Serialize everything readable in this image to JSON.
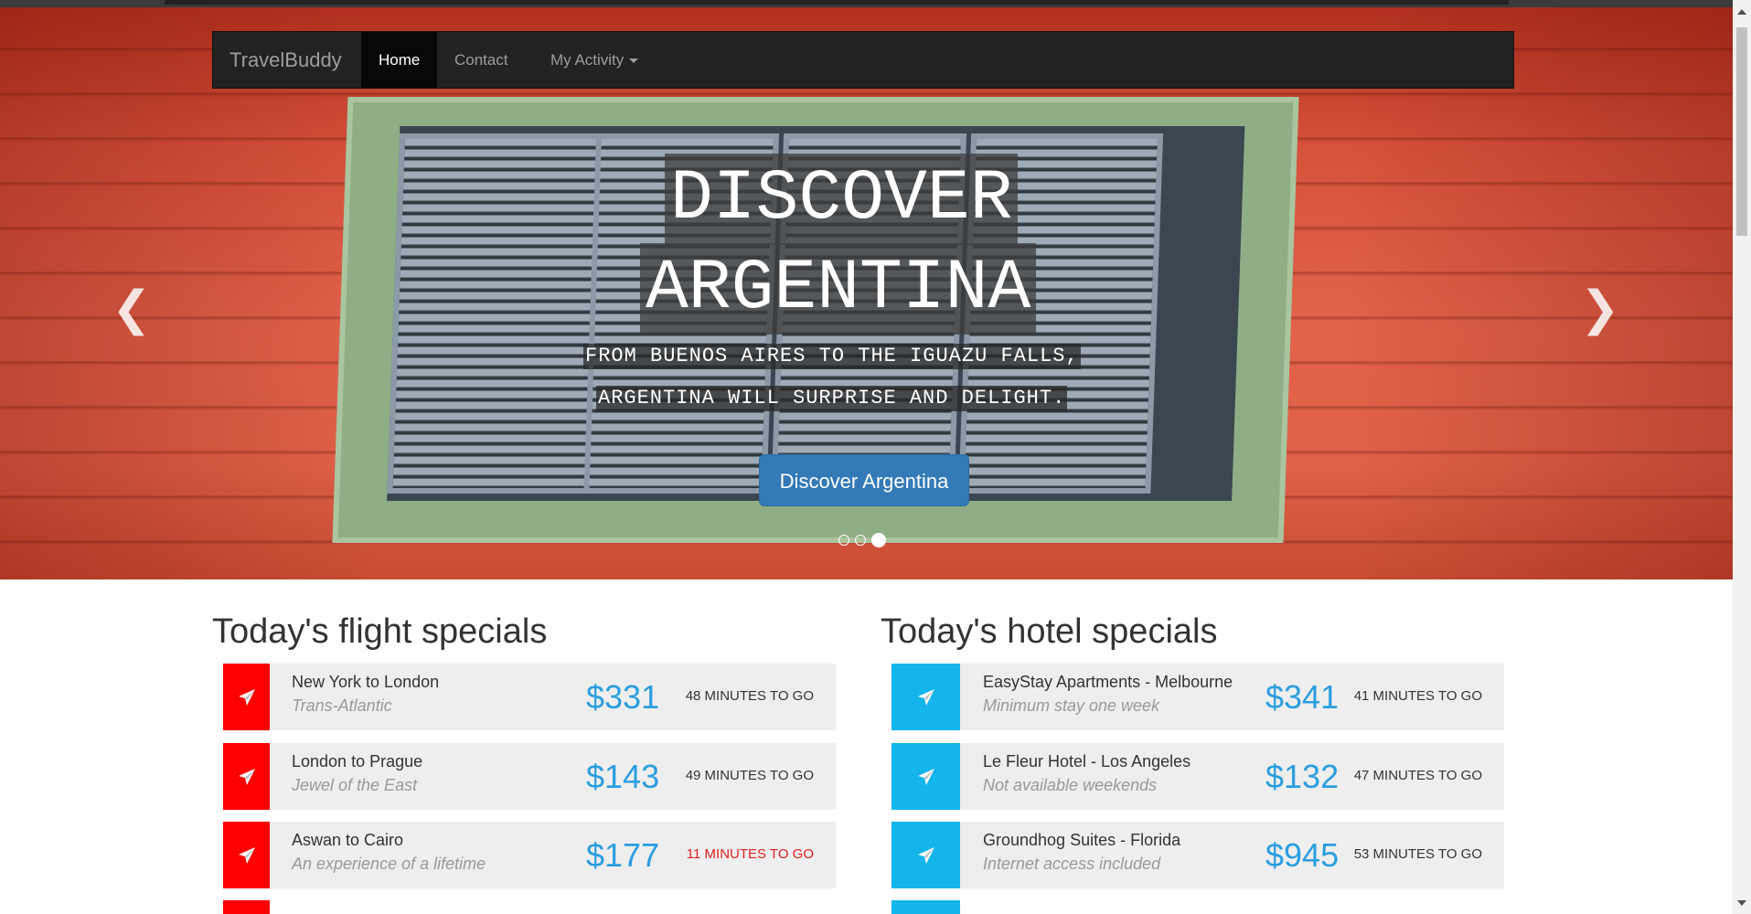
{
  "nav": {
    "brand": "TravelBuddy",
    "items": [
      {
        "label": "Home",
        "active": true
      },
      {
        "label": "Contact",
        "active": false
      },
      {
        "label": "My Activity",
        "active": false,
        "dropdown": true
      }
    ]
  },
  "hero": {
    "headline_line1": "DISCOVER",
    "headline_line2": "ARGENTINA",
    "subline1": "FROM BUENOS AIRES TO THE IGUAZU FALLS,",
    "subline2": "ARGENTINA WILL SURPRISE AND DELIGHT.",
    "cta_label": "Discover Argentina",
    "prev_icon": "chevron-left-icon",
    "next_icon": "chevron-right-icon",
    "slide_count": 3,
    "active_slide": 3
  },
  "flights": {
    "title": "Today's flight specials",
    "accent": "#ff0000",
    "icon": "paper-plane-icon",
    "items": [
      {
        "title": "New York to London",
        "subtitle": "Trans-Atlantic",
        "price": "$331",
        "time": "48 MINUTES TO GO",
        "urgent": false
      },
      {
        "title": "London to Prague",
        "subtitle": "Jewel of the East",
        "price": "$143",
        "time": "49 MINUTES TO GO",
        "urgent": false
      },
      {
        "title": "Aswan to Cairo",
        "subtitle": "An experience of a lifetime",
        "price": "$177",
        "time": "11 MINUTES TO GO",
        "urgent": true
      }
    ]
  },
  "hotels": {
    "title": "Today's hotel specials",
    "accent": "#13b5ea",
    "icon": "paper-plane-icon",
    "items": [
      {
        "title": "EasyStay Apartments - Melbourne",
        "subtitle": "Minimum stay one week",
        "price": "$341",
        "time": "41 MINUTES TO GO",
        "urgent": false
      },
      {
        "title": "Le Fleur Hotel - Los Angeles",
        "subtitle": "Not available weekends",
        "price": "$132",
        "time": "47 MINUTES TO GO",
        "urgent": false
      },
      {
        "title": "Groundhog Suites - Florida",
        "subtitle": "Internet access included",
        "price": "$945",
        "time": "53 MINUTES TO GO",
        "urgent": false
      }
    ]
  },
  "colors": {
    "price": "#2b9ee0",
    "urgent": "#e02020",
    "button": "#337ab7",
    "navbar": "#222222"
  }
}
